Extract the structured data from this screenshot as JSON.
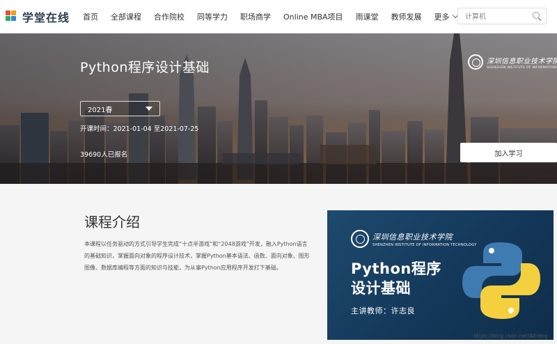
{
  "brand": {
    "name": "学堂在线"
  },
  "nav": {
    "items": [
      "首页",
      "全部课程",
      "合作院校",
      "同等学力",
      "职场商学",
      "Online MBA项目",
      "雨课堂",
      "教师发展"
    ],
    "more_label": "更多"
  },
  "search": {
    "placeholder": "计算机"
  },
  "course": {
    "title": "Python程序设计基础",
    "semester": "2021春",
    "dates": "开课时间：2021-01-04 至2021-07-25",
    "enrolled": "39690人已报名",
    "join_label": "加入学习"
  },
  "school": {
    "name_cn": "深圳信息职业技术学院",
    "name_en": "SHENZHEN INSTITUTE OF INFORMATION TECHNOLOGY"
  },
  "intro": {
    "title": "课程介绍",
    "text": "本课程以任务驱动的方式引导学生完成“十点半游戏”和“2048游戏”开发，融入Python语言的基础知识，掌握面向对象的程序设计技术，掌握Python基本语法、函数、面向对象、图形图像、数据库编程等方面的知识与技能，为从事Python应用程序开发打下基础。"
  },
  "poster": {
    "title_line1": "Python程序",
    "title_line2": "设计基础",
    "teacher": "主讲教师：许志良"
  },
  "watermark": "https://blog.csdn.net/Aitidog",
  "colors": {
    "poster_bg": "#1d4a6e",
    "python_blue": "#3e7bb0",
    "python_yellow": "#f4d03f"
  }
}
